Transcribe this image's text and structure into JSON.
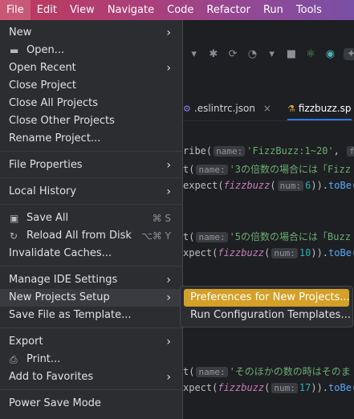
{
  "menubar": {
    "items": [
      "File",
      "Edit",
      "View",
      "Navigate",
      "Code",
      "Refactor",
      "Run",
      "Tools"
    ],
    "active": "File"
  },
  "file_menu": {
    "items": [
      {
        "label": "New",
        "submenu": true
      },
      {
        "label": "Open...",
        "icon": "folder-icon"
      },
      {
        "label": "Open Recent",
        "submenu": true
      },
      {
        "label": "Close Project"
      },
      {
        "label": "Close All Projects"
      },
      {
        "label": "Close Other Projects"
      },
      {
        "label": "Rename Project..."
      },
      {
        "label": "File Properties",
        "submenu": true
      },
      {
        "label": "Local History",
        "submenu": true
      },
      {
        "label": "Save All",
        "icon": "save-icon",
        "shortcut": "⌘ S"
      },
      {
        "label": "Reload All from Disk",
        "icon": "reload-icon",
        "shortcut": "⌥⌘ Y"
      },
      {
        "label": "Invalidate Caches..."
      },
      {
        "label": "Manage IDE Settings",
        "submenu": true
      },
      {
        "label": "New Projects Setup",
        "submenu": true,
        "highlighted": true
      },
      {
        "label": "Save File as Template..."
      },
      {
        "label": "Export",
        "submenu": true
      },
      {
        "label": "Print...",
        "icon": "print-icon"
      },
      {
        "label": "Add to Favorites",
        "submenu": true
      },
      {
        "label": "Power Save Mode"
      }
    ]
  },
  "new_projects_setup_submenu": {
    "items": [
      {
        "label": "Preferences for New Projects...",
        "selected": true
      },
      {
        "label": "Run Configuration Templates..."
      }
    ]
  },
  "tabs": [
    {
      "label": ".eslintrc.json",
      "icon": "gear-icon"
    },
    {
      "label": "fizzbuzz.sp",
      "icon": "flask-icon",
      "active": true
    }
  ],
  "code_lines": {
    "l1": {
      "pre": "ribe(",
      "hint": "name:",
      "str": "'FizzBuzz:1~20'",
      "post": ", ",
      "hint2": "fn"
    },
    "l2": {
      "pre": "t(",
      "hint": "name:",
      "str": "'3の倍数の場合には「Fizz"
    },
    "l3": {
      "pre": "expect(",
      "fn": "fizzbuzz",
      "pre2": "(",
      "hint": "num:",
      "num": "6",
      "post": ")).",
      "fn2": "toBe("
    },
    "l4": {
      "pre": "t(",
      "hint": "name:",
      "str": "'5の倍数の場合には「Buzz"
    },
    "l5": {
      "pre": "xpect(",
      "fn": "fizzbuzz",
      "pre2": "(",
      "hint": "num:",
      "num": "10",
      "post": ")).",
      "fn2": "toBe("
    },
    "l6": {
      "pre": "t(",
      "hint": "name:",
      "str": "'そのほかの数の時はそのま"
    },
    "l7": {
      "pre": "xpect(",
      "fn": "fizzbuzz",
      "pre2": "(",
      "hint": "num:",
      "num": "17",
      "post": ")).",
      "fn2": "toBe("
    }
  },
  "colors": {
    "menu_bg": "#2b2d30",
    "highlight": "#393b40",
    "selected": "#d4a028",
    "editor_bg": "#1e1f22"
  }
}
